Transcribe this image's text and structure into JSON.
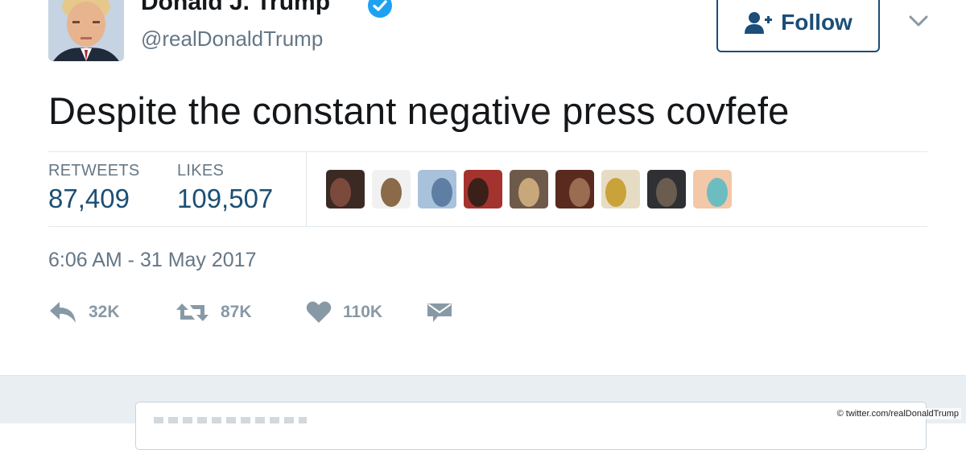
{
  "user": {
    "display_name": "Donald J. Trump",
    "handle": "@realDonaldTrump",
    "verified": true,
    "avatar_icon": "profile-photo"
  },
  "follow_button": {
    "label": "Follow",
    "icon": "add-user-icon"
  },
  "menu": {
    "icon": "chevron-down-icon"
  },
  "tweet": {
    "text": "Despite the constant negative press covfefe",
    "timestamp": "6:06 AM - 31 May 2017"
  },
  "stats": {
    "retweets_label": "RETWEETS",
    "retweets_value": "87,409",
    "likes_label": "LIKES",
    "likes_value": "109,507"
  },
  "likers": [
    {
      "name": "liker-1",
      "colors": [
        "#3b2a24",
        "#7b4a3c"
      ]
    },
    {
      "name": "liker-2",
      "colors": [
        "#f1f1f1",
        "#8a6a48"
      ]
    },
    {
      "name": "liker-3",
      "colors": [
        "#a9c2dc",
        "#5e7fa3"
      ]
    },
    {
      "name": "liker-4",
      "colors": [
        "#a4332f",
        "#3a2018"
      ]
    },
    {
      "name": "liker-5",
      "colors": [
        "#6e5a4a",
        "#c8a87a"
      ]
    },
    {
      "name": "liker-6",
      "colors": [
        "#5a2a1e",
        "#9a6c52"
      ]
    },
    {
      "name": "liker-7",
      "colors": [
        "#e6dcc4",
        "#c9a23a"
      ]
    },
    {
      "name": "liker-8",
      "colors": [
        "#2f3033",
        "#6b5c50"
      ]
    },
    {
      "name": "liker-9",
      "colors": [
        "#f2c8a8",
        "#6cbcc0"
      ]
    }
  ],
  "actions": {
    "reply_count": "32K",
    "retweet_count": "87K",
    "like_count": "110K"
  },
  "colors": {
    "link_blue": "#1c4f74",
    "verified_blue": "#1da1f2",
    "muted_gray": "#657786",
    "icon_gray": "#8899a6"
  },
  "credit": "© twitter.com/realDonaldTrump"
}
